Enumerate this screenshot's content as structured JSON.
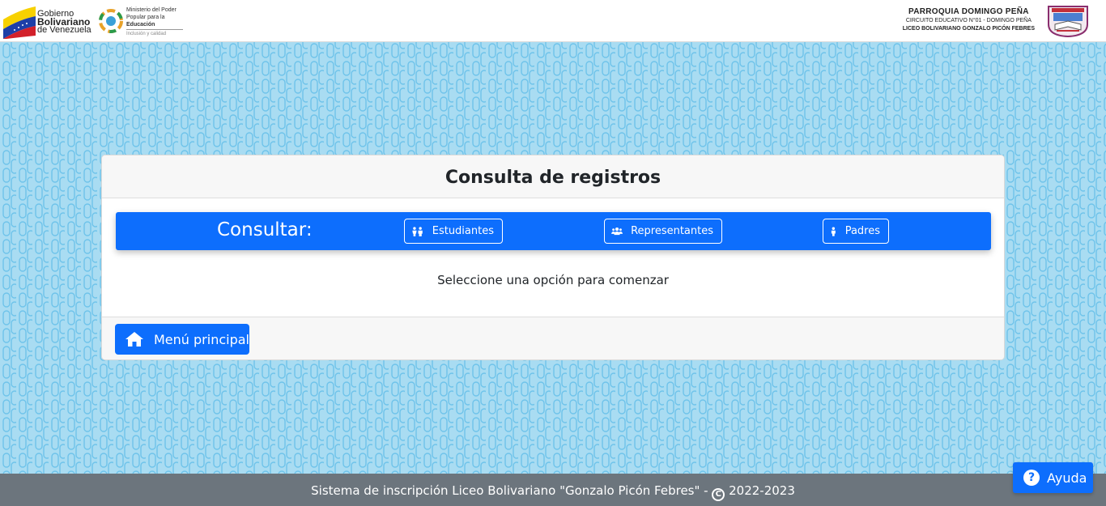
{
  "header": {
    "gov_line1": "Gobierno",
    "gov_line2": "Bolivariano",
    "gov_line3": "de Venezuela",
    "ministry_line1": "Ministerio del Poder",
    "ministry_line2": "Popular para la",
    "ministry_line3": "Educación",
    "ministry_slogan": "Inclusión y calidad",
    "parish": "PARROQUIA DOMINGO PEÑA",
    "circuit": "CIRCUITO EDUCATIVO N°01 - DOMINGO PEÑA",
    "school": "LICEO BOLIVARIANO GONZALO PICÓN FEBRES"
  },
  "card": {
    "title": "Consulta de registros",
    "consult_label": "Consultar:",
    "options": {
      "students": "Estudiantes",
      "representatives": "Representantes",
      "parents": "Padres"
    },
    "message": "Seleccione una opción para comenzar",
    "menu_button": "Menú principal"
  },
  "footer": {
    "text": "Sistema de inscripción Liceo Bolivariano \"Gonzalo Picón Febres\" - ",
    "copyright_symbol": "C",
    "years": " 2022-2023"
  },
  "help_button": "Ayuda",
  "colors": {
    "primary": "#0d6efd",
    "pattern_bg": "#a9dcf2",
    "pattern_stroke": "#6ec3ea",
    "footer_bg": "#6c757d"
  }
}
